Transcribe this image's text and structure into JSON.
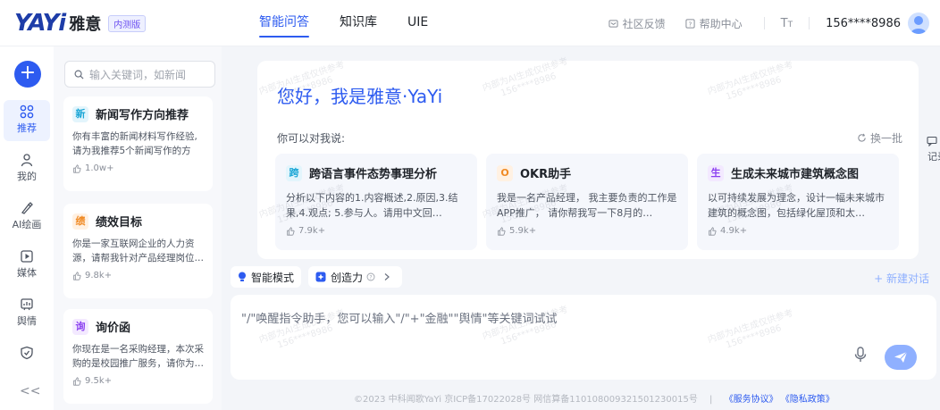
{
  "header": {
    "logo_mark": "YAYi",
    "logo_name": "雅意",
    "logo_badge": "内测版",
    "nav": [
      "智能问答",
      "知识库",
      "UIE"
    ],
    "active_nav": 0,
    "feedback_label": "社区反馈",
    "help_label": "帮助中心",
    "font_label": "TT",
    "phone": "156****8986"
  },
  "rail": {
    "items": [
      {
        "label": "推荐",
        "icon": "grid-icon",
        "active": true
      },
      {
        "label": "我的",
        "icon": "user-icon"
      },
      {
        "label": "AI绘画",
        "icon": "brush-icon"
      },
      {
        "label": "媒体",
        "icon": "play-icon"
      },
      {
        "label": "舆情",
        "icon": "chart-icon"
      },
      {
        "label": "",
        "icon": "shield-icon"
      }
    ],
    "collapse": "<<"
  },
  "sidebar": {
    "search_placeholder": "输入关键词，如新闻",
    "cards": [
      {
        "tag": "新",
        "tag_color": "#1aa6d6",
        "tag_bg": "#e3f5fc",
        "title": "新闻写作方向推荐",
        "desc": "你有丰富的新闻材料写作经验,请为我推荐5个新闻写作的方向…",
        "likes": "1.0w+"
      },
      {
        "tag": "绩",
        "tag_color": "#f08a24",
        "tag_bg": "#fff1e3",
        "title": "绩效目标",
        "desc": "你是一家互联网企业的人力资源，请帮我针对产品经理岗位…",
        "likes": "9.8k+"
      },
      {
        "tag": "询",
        "tag_color": "#8a3ff0",
        "tag_bg": "#f3e9ff",
        "title": "询价函",
        "desc": "你现在是一名采购经理，本次采购的是校园推广服务，请你为…",
        "likes": "9.5k+"
      }
    ]
  },
  "main": {
    "welcome": "您好，我是雅意·YaYi",
    "say_label": "你可以对我说:",
    "refresh_label": "换一批",
    "suggestions": [
      {
        "tag": "跨",
        "tag_color": "#1aa6d6",
        "tag_bg": "#e3f5fc",
        "title": "跨语言事件态势事理分析",
        "desc": "分析以下内容的1.内容概述,2.原因,3.结果,4.观点; 5.参与人。请用中文回…",
        "likes": "7.9k+"
      },
      {
        "tag": "O",
        "tag_color": "#f08a24",
        "tag_bg": "#fff1e3",
        "title": "OKR助手",
        "desc": "我是一名产品经理， 我主要负责的工作是APP推广， 请你帮我写一下8月的…",
        "likes": "5.9k+"
      },
      {
        "tag": "生",
        "tag_color": "#8a3ff0",
        "tag_bg": "#f3e9ff",
        "title": "生成未来城市建筑概念图",
        "desc": "以可持续发展为理念，设计一幅未来城市建筑的概念图，包括绿化屋顶和太…",
        "likes": "4.9k+"
      }
    ],
    "mode_label": "智能模式",
    "creativity_label": "创造力",
    "new_chat_label": "+ 新建对话",
    "input_placeholder": "\"/\"唤醒指令助手，您可以输入\"/\"+\"金融\"\"舆情\"等关键词试试",
    "right_edge_label": "记录"
  },
  "footer": {
    "copyright": "©2023 中科闻歌YaYi  京ICP备17022028号  网信算备110108009321501230015号",
    "sep": "|",
    "service_link": "《服务协议》",
    "privacy_link": "《隐私政策》"
  },
  "watermark": {
    "line1": "内部为AI生成仅供参考",
    "line2": "156****8986"
  },
  "colors": {
    "accent": "#2d5bf0",
    "send_button": "#8fb0ff"
  }
}
